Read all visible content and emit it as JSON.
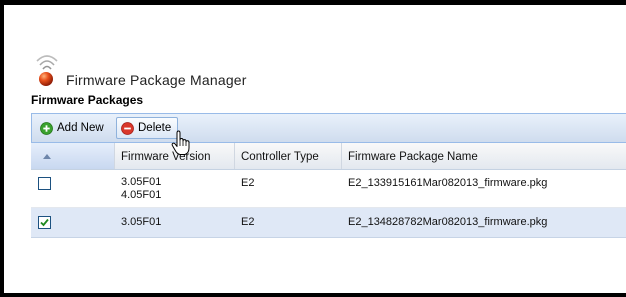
{
  "app": {
    "title": "Firmware Package Manager",
    "logo_icon": "radio-signal-logo-icon"
  },
  "section": {
    "title": "Firmware Packages"
  },
  "toolbar": {
    "add_label": "Add New",
    "add_icon": "add-circle-icon",
    "delete_label": "Delete",
    "delete_icon": "remove-circle-icon"
  },
  "grid": {
    "columns": {
      "select": "",
      "firmware_version": "Firmware Version",
      "controller_type": "Controller Type",
      "package_name": "Firmware Package Name"
    },
    "rows": [
      {
        "checked": false,
        "firmware_version_1": "3.05F01",
        "firmware_version_2": "4.05F01",
        "controller_type": "E2",
        "package_name": "E2_133915161Mar082013_firmware.pkg"
      },
      {
        "checked": true,
        "firmware_version_1": "3.05F01",
        "controller_type": "E2",
        "package_name": "E2_134828782Mar082013_firmware.pkg"
      }
    ]
  },
  "colors": {
    "toolbar_border": "#99bbe8",
    "selected_row": "#dfe8f6",
    "add_green": "#3aa12e",
    "delete_red": "#d9372b",
    "logo_orange": "#e0481a"
  }
}
